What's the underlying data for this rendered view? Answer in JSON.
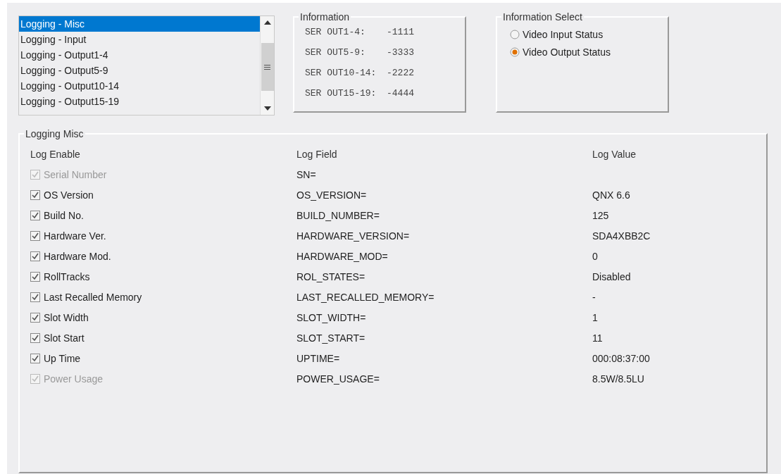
{
  "log_list": {
    "items": [
      {
        "label": "Logging - Misc",
        "selected": true
      },
      {
        "label": "Logging - Input",
        "selected": false
      },
      {
        "label": "Logging - Output1-4",
        "selected": false
      },
      {
        "label": "Logging - Output5-9",
        "selected": false
      },
      {
        "label": "Logging - Output10-14",
        "selected": false
      },
      {
        "label": "Logging - Output15-19",
        "selected": false
      }
    ]
  },
  "information": {
    "title": "Information",
    "lines": [
      {
        "label": "SER OUT1-4:",
        "value": "-1111"
      },
      {
        "label": "SER OUT5-9:",
        "value": "-3333"
      },
      {
        "label": "SER OUT10-14:",
        "value": "-2222"
      },
      {
        "label": "SER OUT15-19:",
        "value": "-4444"
      }
    ]
  },
  "information_select": {
    "title": "Information Select",
    "options": [
      {
        "label": "Video Input Status",
        "selected": false
      },
      {
        "label": "Video Output Status",
        "selected": true
      }
    ]
  },
  "logging_misc": {
    "title": "Logging Misc",
    "columns": [
      "Log Enable",
      "Log Field",
      "Log Value"
    ],
    "rows": [
      {
        "label": "Serial Number",
        "checked": true,
        "disabled": true,
        "field": "SN="
      },
      {
        "label": "OS Version",
        "checked": true,
        "disabled": false,
        "field": "OS_VERSION=",
        "value": "QNX 6.6"
      },
      {
        "label": "Build No.",
        "checked": true,
        "disabled": false,
        "field": "BUILD_NUMBER=",
        "value": "125"
      },
      {
        "label": "Hardware Ver.",
        "checked": true,
        "disabled": false,
        "field": "HARDWARE_VERSION=",
        "value": "SDA4XBB2C"
      },
      {
        "label": "Hardware Mod.",
        "checked": true,
        "disabled": false,
        "field": "HARDWARE_MOD=",
        "value": "0"
      },
      {
        "label": "RollTracks",
        "checked": true,
        "disabled": false,
        "field": "ROL_STATES=",
        "value": "Disabled"
      },
      {
        "label": "Last Recalled Memory",
        "checked": true,
        "disabled": false,
        "field": "LAST_RECALLED_MEMORY=",
        "value": "-"
      },
      {
        "label": "Slot Width",
        "checked": true,
        "disabled": false,
        "field": "SLOT_WIDTH=",
        "value": "1"
      },
      {
        "label": "Slot Start",
        "checked": true,
        "disabled": false,
        "field": "SLOT_START=",
        "value": "11"
      },
      {
        "label": "Up Time",
        "checked": true,
        "disabled": false,
        "field": "UPTIME=",
        "value": "000:08:37:00"
      },
      {
        "label": "Power Usage",
        "checked": true,
        "disabled": true,
        "field": "POWER_USAGE=",
        "value": "8.5W/8.5LU"
      }
    ]
  }
}
